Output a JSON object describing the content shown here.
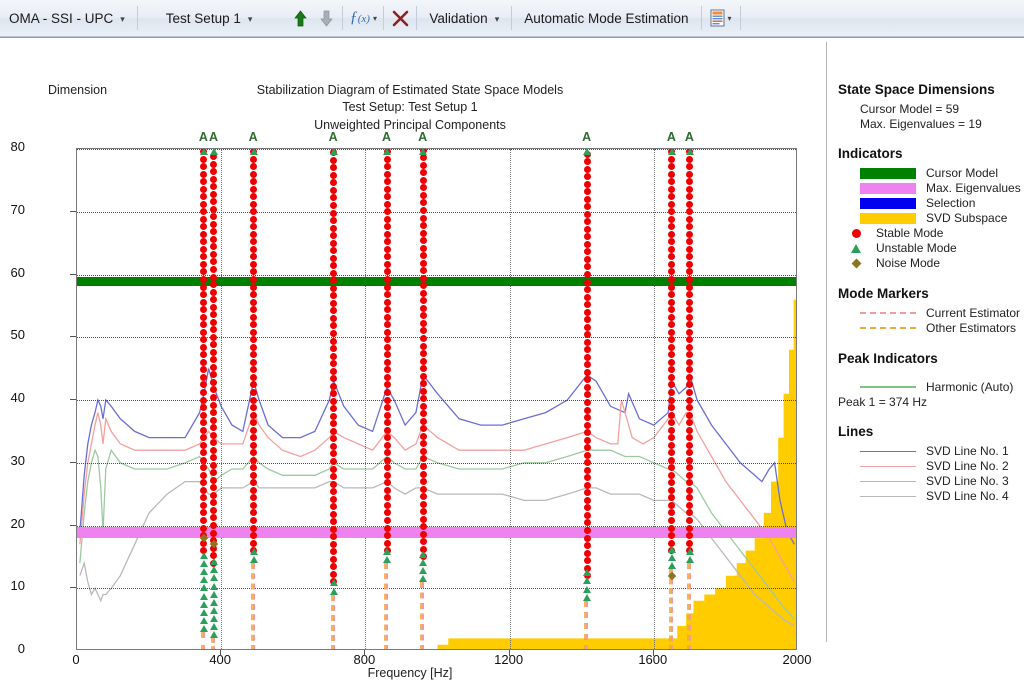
{
  "toolbar": {
    "app_menu": "OMA - SSI - UPC",
    "test_setup": "Test Setup 1",
    "up_icon": "arrow-up-icon",
    "down_icon": "arrow-down-icon",
    "fx_icon": "function-icon",
    "delete_icon": "delete-x-icon",
    "validation": "Validation",
    "auto_mode": "Automatic Mode Estimation",
    "report_icon": "report-icon"
  },
  "plot": {
    "dimension_label": "Dimension",
    "title1": "Stabilization Diagram of Estimated State Space Models",
    "title2": "Test Setup: Test Setup 1",
    "title3": "Unweighted Principal Components",
    "xlabel": "Frequency [Hz]"
  },
  "legend": {
    "dims_heading": "State Space Dimensions",
    "cursor_model": "Cursor Model = 59",
    "max_eigen": "Max. Eigenvalues = 19",
    "indicators_heading": "Indicators",
    "ind_cursor": "Cursor Model",
    "ind_eigen": "Max. Eigenvalues",
    "ind_selection": "Selection",
    "ind_svd": "SVD Subspace",
    "ind_stable": "Stable Mode",
    "ind_unstable": "Unstable Mode",
    "ind_noise": "Noise Mode",
    "markers_heading": "Mode Markers",
    "mk_current": "Current Estimator",
    "mk_other": "Other Estimators",
    "peaks_heading": "Peak Indicators",
    "pk_harmonic": "Harmonic (Auto)",
    "pk_peak1": "Peak 1 = 374 Hz",
    "lines_heading": "Lines",
    "ln1": "SVD Line No. 1",
    "ln2": "SVD Line No. 2",
    "ln3": "SVD Line No. 3",
    "ln4": "SVD Line No. 4"
  },
  "colors": {
    "cursor_model": "#008000",
    "max_eigen": "#ee82ee",
    "selection": "#0000ee",
    "svd_subspace": "#ffcc00",
    "stable": "#ee0000",
    "unstable": "#2ca05a",
    "noise": "#8a7520",
    "current_estimator": "#f49a9a",
    "other_estimators": "#f2a93b",
    "harmonic": "#7fc08a",
    "svd1": "#6b6fd4",
    "svd2": "#f4a0a0",
    "svd3": "#9ec9a0",
    "svd4": "#b9b9b9"
  },
  "chart_data": {
    "type": "line",
    "title": "Stabilization Diagram of Estimated State Space Models",
    "subtitle": "Test Setup: Test Setup 1 / Unweighted Principal Components",
    "xlabel": "Frequency [Hz]",
    "ylabel": "Dimension",
    "xlim": [
      0,
      2000
    ],
    "ylim": [
      0,
      80
    ],
    "xticks": [
      0,
      400,
      800,
      1200,
      1600,
      2000
    ],
    "yticks": [
      0,
      10,
      20,
      30,
      40,
      50,
      60,
      70,
      80
    ],
    "grid": true,
    "cursor_model_dimension": 59,
    "max_eigenvalues_dimension": 19,
    "peak1_hz": 374,
    "mode_columns": [
      {
        "freq": 352,
        "label": "A",
        "stable_top": 80,
        "stable_bottom": 16,
        "unstable_bottom": 3,
        "noise": 18
      },
      {
        "freq": 380,
        "label": "A",
        "stable_top": 80,
        "stable_bottom": 14,
        "unstable_bottom": 2,
        "noise": 17
      },
      {
        "freq": 490,
        "label": "A",
        "stable_top": 80,
        "stable_bottom": 16,
        "unstable_bottom": 14,
        "noise": null
      },
      {
        "freq": 712,
        "label": "A",
        "stable_top": 80,
        "stable_bottom": 11,
        "unstable_bottom": 9,
        "noise": null
      },
      {
        "freq": 860,
        "label": "A",
        "stable_top": 80,
        "stable_bottom": 16,
        "unstable_bottom": 14,
        "noise": null
      },
      {
        "freq": 960,
        "label": "A",
        "stable_top": 80,
        "stable_bottom": 15,
        "unstable_bottom": 11,
        "noise": null
      },
      {
        "freq": 1415,
        "label": "A",
        "stable_top": 80,
        "stable_bottom": 12,
        "unstable_bottom": 8,
        "noise": null
      },
      {
        "freq": 1650,
        "label": "A",
        "stable_top": 80,
        "stable_bottom": 16,
        "unstable_bottom": 13,
        "noise": 12
      },
      {
        "freq": 1700,
        "label": "A",
        "stable_top": 80,
        "stable_bottom": 16,
        "unstable_bottom": 14,
        "noise": null
      }
    ],
    "series": [
      {
        "name": "SVD Line No. 1",
        "color": "#6b6fd4",
        "x": [
          8,
          20,
          30,
          40,
          50,
          58,
          66,
          72,
          80,
          95,
          120,
          160,
          200,
          250,
          300,
          340,
          352,
          365,
          380,
          400,
          430,
          460,
          490,
          505,
          530,
          570,
          620,
          660,
          700,
          712,
          740,
          780,
          820,
          860,
          880,
          910,
          940,
          960,
          1000,
          1060,
          1120,
          1180,
          1240,
          1300,
          1360,
          1415,
          1440,
          1480,
          1520,
          1530,
          1560,
          1600,
          1640,
          1650,
          1670,
          1690,
          1700,
          1720,
          1760,
          1800,
          1840,
          1880,
          1900,
          1920,
          1935,
          1950,
          1970,
          1990
        ],
        "y": [
          19,
          28,
          33,
          36,
          38,
          40,
          39,
          37,
          40,
          39,
          37,
          35,
          34,
          34,
          34,
          38,
          41,
          45,
          42,
          39,
          36,
          35,
          43,
          40,
          36,
          34,
          34,
          35,
          40,
          43,
          39,
          36,
          35,
          42,
          40,
          36,
          38,
          44,
          41,
          37,
          36,
          36,
          37,
          38,
          40,
          44,
          43,
          39,
          38,
          41,
          37,
          36,
          38,
          43,
          41,
          42,
          44,
          40,
          36,
          33,
          30,
          28,
          27,
          29,
          30,
          24,
          19,
          17
        ]
      },
      {
        "name": "SVD Line No. 2",
        "color": "#f4a0a0",
        "x": [
          8,
          20,
          30,
          40,
          50,
          58,
          66,
          72,
          80,
          95,
          120,
          160,
          200,
          250,
          300,
          340,
          352,
          365,
          380,
          400,
          430,
          460,
          490,
          505,
          530,
          570,
          620,
          660,
          700,
          712,
          740,
          780,
          820,
          860,
          880,
          910,
          940,
          960,
          1000,
          1060,
          1120,
          1180,
          1240,
          1300,
          1360,
          1415,
          1440,
          1480,
          1500,
          1510,
          1540,
          1570,
          1600,
          1640,
          1650,
          1670,
          1690,
          1700,
          1720,
          1760,
          1800,
          1840,
          1880,
          1920,
          1960,
          1990
        ],
        "y": [
          17,
          25,
          30,
          33,
          36,
          38,
          36,
          33,
          37,
          35,
          33,
          32,
          32,
          32,
          32,
          33,
          34,
          35,
          34,
          33,
          33,
          33,
          38,
          36,
          34,
          32,
          31,
          32,
          34,
          35,
          34,
          33,
          32,
          35,
          34,
          32,
          33,
          36,
          34,
          32,
          32,
          32,
          32,
          33,
          34,
          35,
          34,
          33,
          33,
          40,
          34,
          33,
          34,
          37,
          38,
          36,
          38,
          38,
          35,
          31,
          27,
          24,
          21,
          18,
          14,
          11
        ]
      },
      {
        "name": "SVD Line No. 3",
        "color": "#9ec9a0",
        "x": [
          8,
          20,
          30,
          40,
          50,
          58,
          66,
          72,
          80,
          95,
          120,
          160,
          200,
          250,
          300,
          340,
          352,
          365,
          380,
          400,
          430,
          460,
          490,
          505,
          530,
          570,
          620,
          660,
          700,
          712,
          740,
          780,
          820,
          860,
          880,
          910,
          940,
          960,
          1000,
          1060,
          1120,
          1180,
          1240,
          1300,
          1360,
          1415,
          1440,
          1480,
          1520,
          1560,
          1600,
          1640,
          1650,
          1670,
          1690,
          1700,
          1720,
          1760,
          1800,
          1840,
          1880,
          1920,
          1960,
          1990
        ],
        "y": [
          14,
          22,
          27,
          30,
          32,
          31,
          26,
          19,
          29,
          32,
          30,
          29,
          29,
          29,
          30,
          31,
          30,
          29,
          27,
          28,
          29,
          29,
          31,
          30,
          29,
          28,
          28,
          28,
          29,
          30,
          29,
          29,
          29,
          31,
          30,
          29,
          29,
          31,
          30,
          29,
          29,
          29,
          30,
          30,
          31,
          32,
          32,
          32,
          31,
          31,
          30,
          29,
          29,
          28,
          27,
          27,
          26,
          22,
          19,
          16,
          13,
          10,
          7,
          5
        ]
      },
      {
        "name": "SVD Line No. 4",
        "color": "#b9b9b9",
        "x": [
          8,
          20,
          30,
          40,
          50,
          58,
          66,
          72,
          80,
          95,
          120,
          160,
          200,
          250,
          300,
          340,
          352,
          365,
          380,
          400,
          430,
          460,
          490,
          505,
          530,
          570,
          620,
          660,
          700,
          712,
          740,
          780,
          820,
          860,
          880,
          910,
          940,
          960,
          1000,
          1060,
          1120,
          1180,
          1240,
          1300,
          1360,
          1415,
          1440,
          1480,
          1520,
          1560,
          1600,
          1640,
          1650,
          1670,
          1690,
          1700,
          1720,
          1760,
          1800,
          1840,
          1880,
          1920,
          1960,
          1990
        ],
        "y": [
          12,
          14,
          11,
          9,
          10,
          9,
          8,
          9,
          9,
          10,
          12,
          17,
          22,
          25,
          27,
          27,
          26,
          25,
          25,
          26,
          26,
          26,
          27,
          26,
          26,
          26,
          26,
          26,
          27,
          27,
          26,
          26,
          26,
          27,
          26,
          25,
          26,
          26,
          25,
          25,
          25,
          25,
          24,
          24,
          25,
          26,
          26,
          25,
          25,
          25,
          24,
          24,
          24,
          23,
          22,
          22,
          21,
          18,
          15,
          12,
          9,
          7,
          5,
          4
        ]
      }
    ],
    "svd_subspace_steps": [
      {
        "x": 1000,
        "y": 1
      },
      {
        "x": 1030,
        "y": 2
      },
      {
        "x": 1160,
        "y": 2
      },
      {
        "x": 1630,
        "y": 2
      },
      {
        "x": 1665,
        "y": 4
      },
      {
        "x": 1690,
        "y": 6
      },
      {
        "x": 1710,
        "y": 8
      },
      {
        "x": 1740,
        "y": 9
      },
      {
        "x": 1770,
        "y": 10
      },
      {
        "x": 1800,
        "y": 12
      },
      {
        "x": 1830,
        "y": 14
      },
      {
        "x": 1855,
        "y": 16
      },
      {
        "x": 1880,
        "y": 18
      },
      {
        "x": 1905,
        "y": 22
      },
      {
        "x": 1925,
        "y": 27
      },
      {
        "x": 1945,
        "y": 34
      },
      {
        "x": 1960,
        "y": 41
      },
      {
        "x": 1975,
        "y": 48
      },
      {
        "x": 1988,
        "y": 56
      },
      {
        "x": 2000,
        "y": 62
      }
    ]
  }
}
